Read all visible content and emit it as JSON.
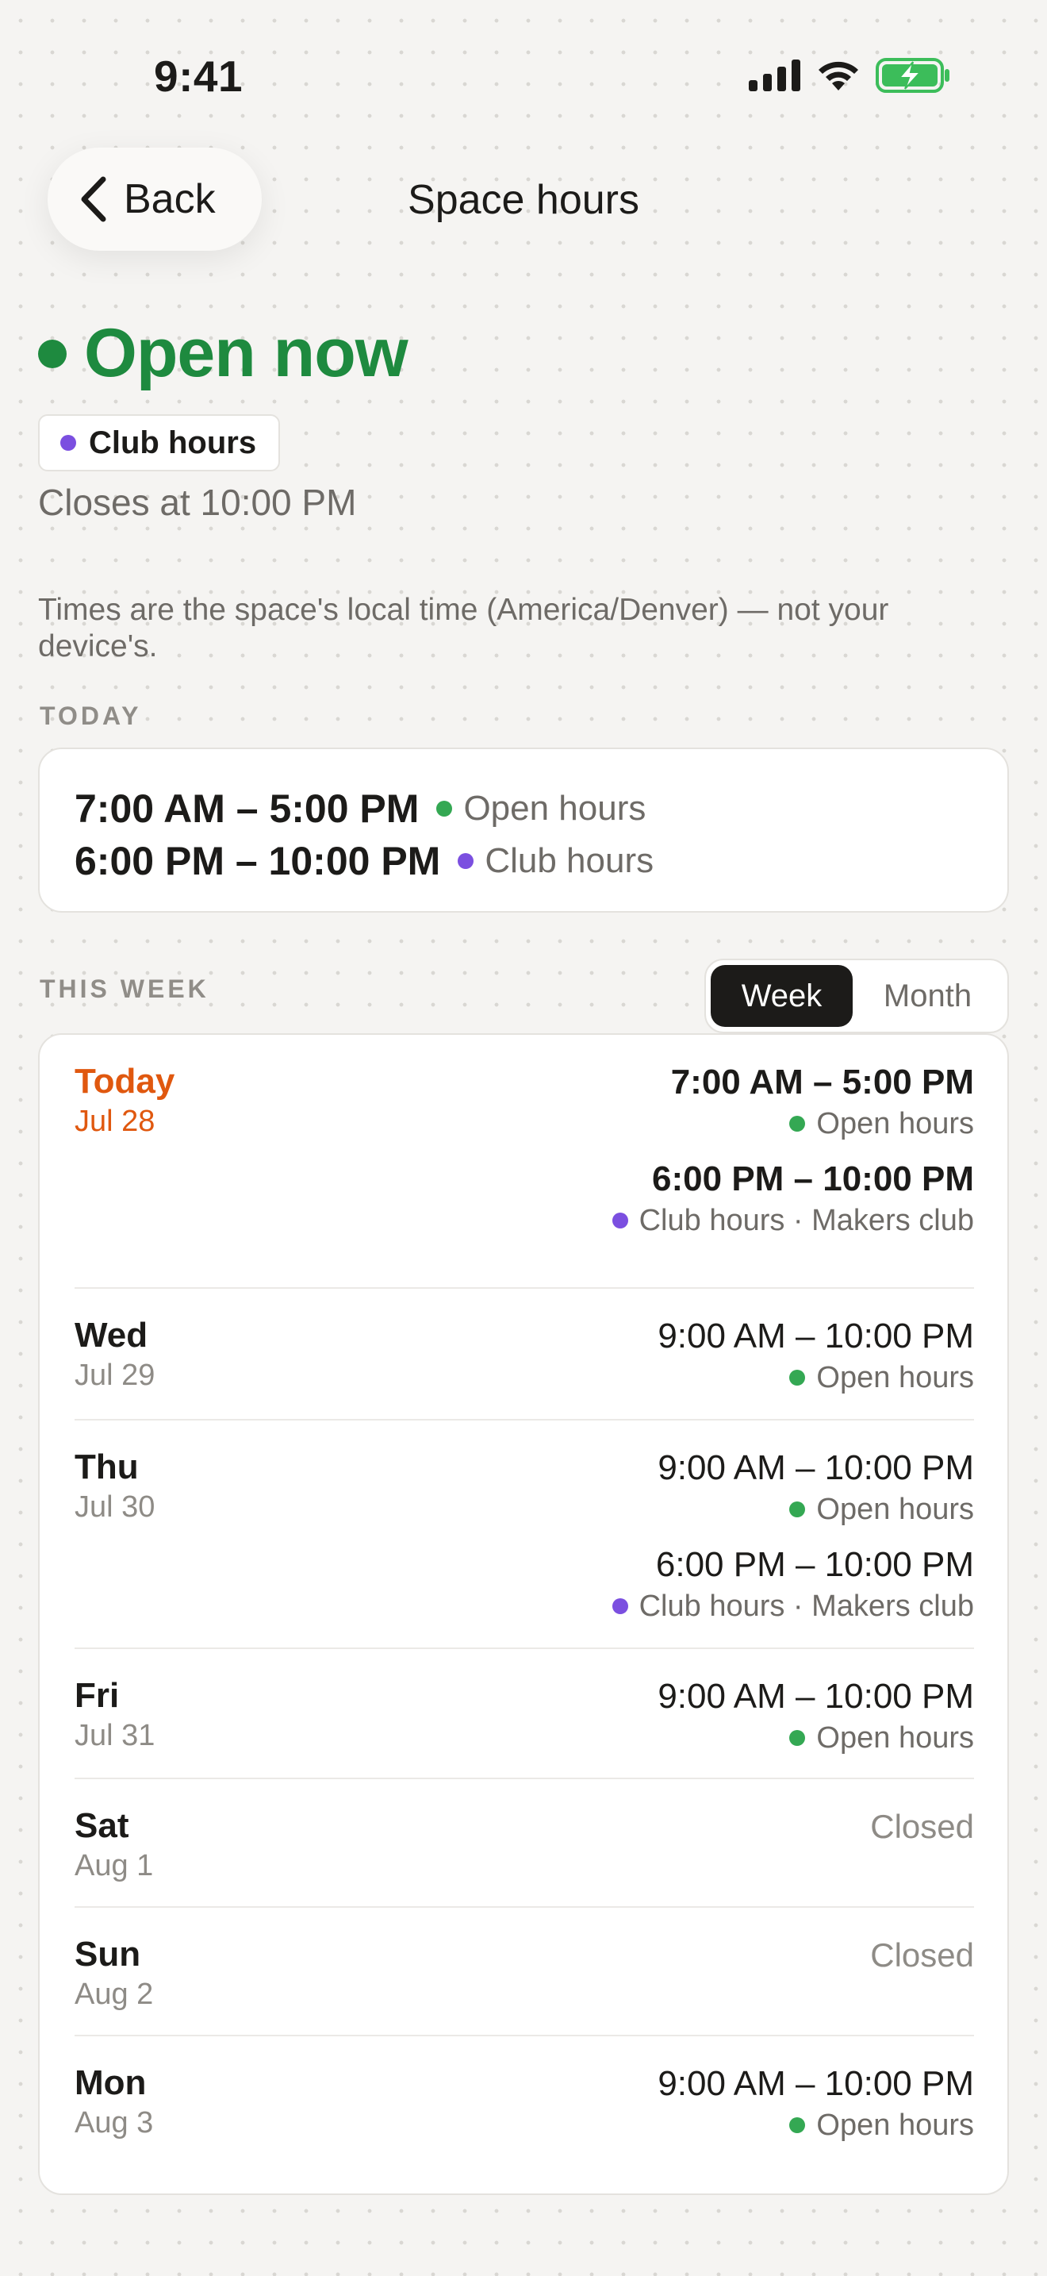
{
  "status_bar": {
    "time": "9:41"
  },
  "nav": {
    "back_label": "Back",
    "title": "Space hours"
  },
  "status": {
    "headline": "Open now",
    "chip_label": "Club hours",
    "closes_text": "Closes at 10:00 PM"
  },
  "timezone_note": "Times are the space's local time (America/Denver) — not your device's.",
  "colors": {
    "open": "#1e8a3f",
    "club": "#7b4fe0",
    "today_accent": "#e0580f"
  },
  "today": {
    "label": "TODAY",
    "entries": [
      {
        "range": "7:00 AM – 5:00 PM",
        "kind": "Open hours",
        "color": "#34a853"
      },
      {
        "range": "6:00 PM – 10:00 PM",
        "kind": "Club hours",
        "color": "#7b4fe0"
      }
    ]
  },
  "week": {
    "label": "THIS WEEK",
    "toggle": {
      "week": "Week",
      "month": "Month"
    },
    "days": [
      {
        "name": "Today",
        "date": "Jul 28",
        "slots": [
          {
            "range": "7:00 AM – 5:00 PM",
            "kind": "Open hours",
            "color": "#34a853"
          },
          {
            "range": "6:00 PM – 10:00 PM",
            "kind": "Club hours · Makers club",
            "color": "#7b4fe0"
          }
        ]
      },
      {
        "name": "Wed",
        "date": "Jul 29",
        "slots": [
          {
            "range": "9:00 AM – 10:00 PM",
            "kind": "Open hours",
            "color": "#34a853"
          }
        ]
      },
      {
        "name": "Thu",
        "date": "Jul 30",
        "slots": [
          {
            "range": "9:00 AM – 10:00 PM",
            "kind": "Open hours",
            "color": "#34a853"
          },
          {
            "range": "6:00 PM – 10:00 PM",
            "kind": "Club hours · Makers club",
            "color": "#7b4fe0"
          }
        ]
      },
      {
        "name": "Fri",
        "date": "Jul 31",
        "slots": [
          {
            "range": "9:00 AM – 10:00 PM",
            "kind": "Open hours",
            "color": "#34a853"
          }
        ]
      },
      {
        "name": "Sat",
        "date": "Aug 1",
        "closed_label": "Closed",
        "slots": []
      },
      {
        "name": "Sun",
        "date": "Aug 2",
        "closed_label": "Closed",
        "slots": []
      },
      {
        "name": "Mon",
        "date": "Aug 3",
        "slots": [
          {
            "range": "9:00 AM – 10:00 PM",
            "kind": "Open hours",
            "color": "#34a853"
          }
        ]
      }
    ]
  }
}
